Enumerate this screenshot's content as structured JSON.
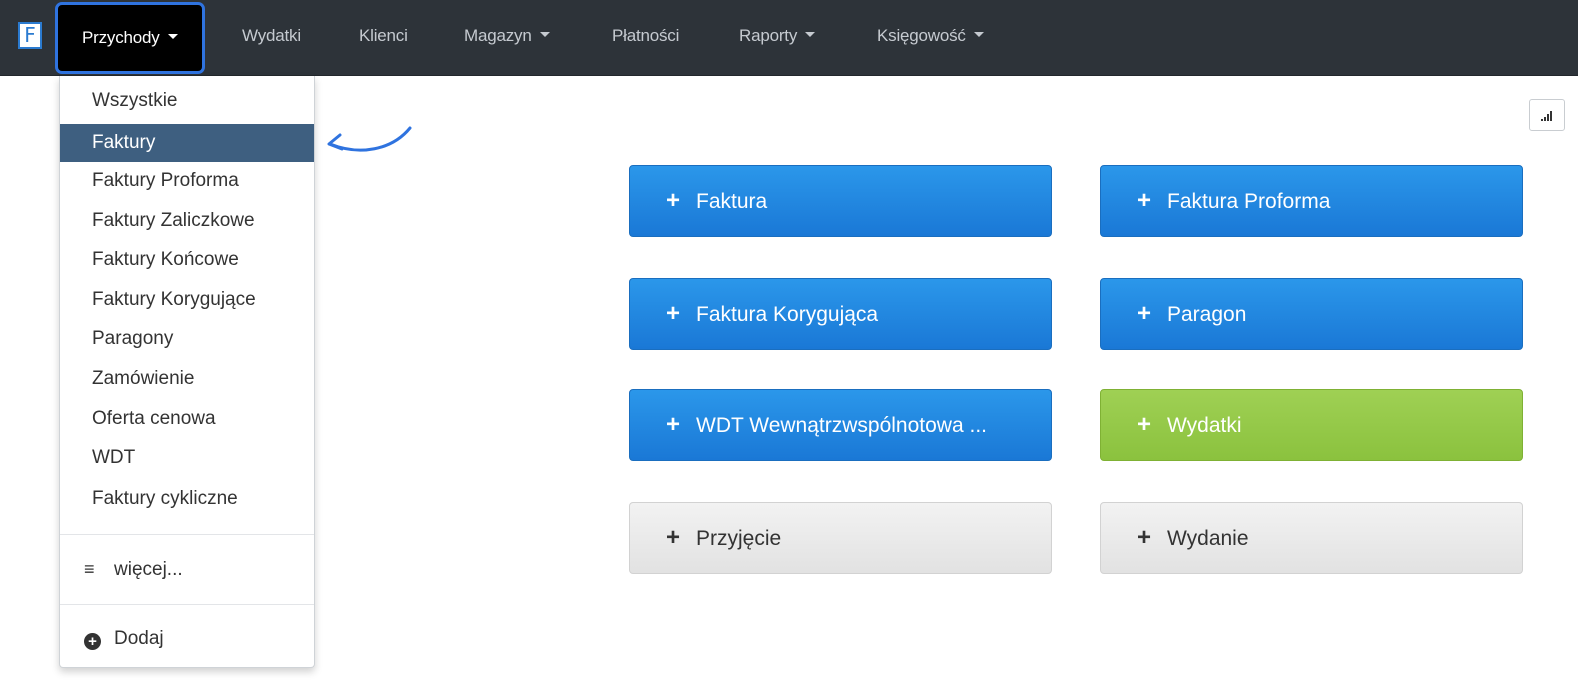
{
  "navbar": {
    "brand_letter": "F",
    "items": [
      {
        "label": "Przychody",
        "has_caret": true,
        "active": true
      },
      {
        "label": "Wydatki",
        "has_caret": false
      },
      {
        "label": "Klienci",
        "has_caret": false
      },
      {
        "label": "Magazyn",
        "has_caret": true
      },
      {
        "label": "Płatności",
        "has_caret": false
      },
      {
        "label": "Raporty",
        "has_caret": true
      },
      {
        "label": "Księgowość",
        "has_caret": true
      }
    ]
  },
  "dropdown": {
    "items": [
      {
        "label": "Wszystkie"
      },
      {
        "label": "Faktury",
        "selected": true
      },
      {
        "label": "Faktury Proforma"
      },
      {
        "label": "Faktury Zaliczkowe"
      },
      {
        "label": "Faktury Końcowe"
      },
      {
        "label": "Faktury Korygujące"
      },
      {
        "label": "Paragony"
      },
      {
        "label": "Zamówienie"
      },
      {
        "label": "Oferta cenowa"
      },
      {
        "label": "WDT"
      },
      {
        "label": "Faktury cykliczne"
      }
    ],
    "more_label": "więcej...",
    "add_label": "Dodaj"
  },
  "actions": [
    {
      "label": "Faktura",
      "style": "blue"
    },
    {
      "label": "Faktura Proforma",
      "style": "blue"
    },
    {
      "label": "Faktura Korygująca",
      "style": "blue"
    },
    {
      "label": "Paragon",
      "style": "blue"
    },
    {
      "label": "WDT Wewnątrzwspólnotowa ...",
      "style": "blue"
    },
    {
      "label": "Wydatki",
      "style": "green"
    },
    {
      "label": "Przyjęcie",
      "style": "gray"
    },
    {
      "label": "Wydanie",
      "style": "gray"
    }
  ],
  "colors": {
    "navbar_bg": "#2d3339",
    "active_tab_border": "#2f73df",
    "dropdown_selected": "#3e5f80",
    "btn_blue": "#1f85dd",
    "btn_green": "#92c845",
    "btn_gray": "#e8e8e8",
    "annotation_arrow": "#2f73df"
  },
  "icons": {
    "brand": "app-logo-icon",
    "more": "hamburger-icon",
    "add": "circle-plus-icon",
    "stats": "signal-bars-icon",
    "action": "plus-icon"
  }
}
